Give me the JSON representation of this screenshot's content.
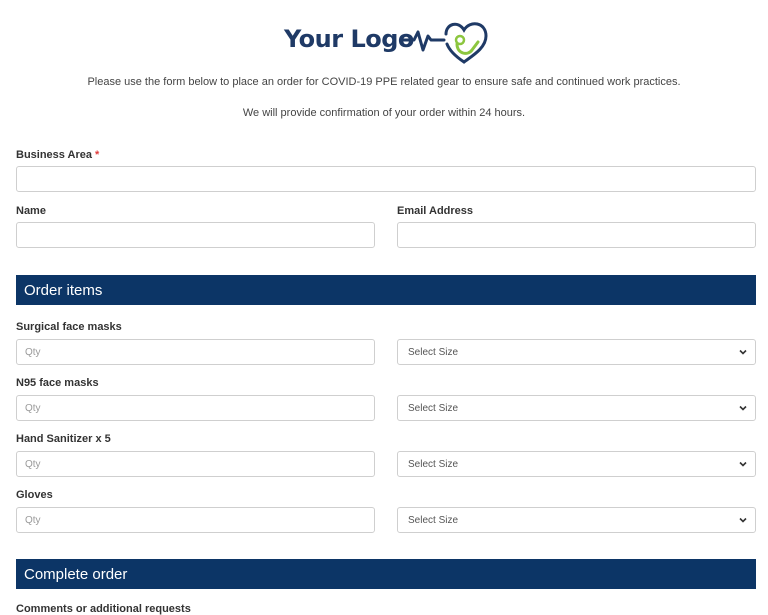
{
  "logo": {
    "text": "Your Logo"
  },
  "intro": {
    "line1": "Please use the form below to place an order for COVID-19 PPE related gear to ensure safe and continued work practices.",
    "line2": "We will provide confirmation of your order within 24 hours."
  },
  "fields": {
    "business_area": {
      "label": "Business Area",
      "required_marker": "*",
      "value": ""
    },
    "name": {
      "label": "Name",
      "value": ""
    },
    "email": {
      "label": "Email Address",
      "value": ""
    }
  },
  "sections": {
    "order_items": "Order items",
    "complete_order": "Complete order"
  },
  "items": [
    {
      "label": "Surgical face masks",
      "qty_placeholder": "Qty",
      "size": "Select Size"
    },
    {
      "label": "N95 face masks",
      "qty_placeholder": "Qty",
      "size": "Select Size"
    },
    {
      "label": "Hand Sanitizer x 5",
      "qty_placeholder": "Qty",
      "size": "Select Size"
    },
    {
      "label": "Gloves",
      "qty_placeholder": "Qty",
      "size": "Select Size"
    }
  ],
  "comments": {
    "label": "Comments or additional requests"
  },
  "colors": {
    "brand_navy": "#0c3566",
    "logo_blue": "#1f3a66",
    "logo_green": "#8cc63f",
    "required_red": "#e03c3c"
  }
}
